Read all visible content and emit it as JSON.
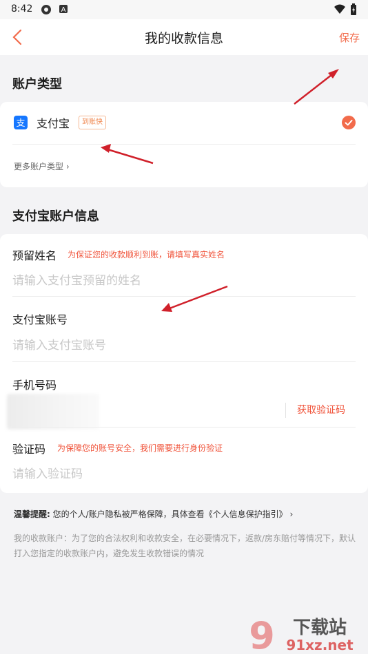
{
  "status": {
    "time": "8:42"
  },
  "header": {
    "title": "我的收款信息",
    "save_label": "保存"
  },
  "account_type": {
    "section_title": "账户类型",
    "option_name": "支付宝",
    "badge": "到账快",
    "more_label": "更多账户类型 ›"
  },
  "account_info": {
    "section_title": "支付宝账户信息",
    "name_label": "预留姓名",
    "name_hint": "为保证您的收款顺利到账，请填写真实姓名",
    "name_placeholder": "请输入支付宝预留的姓名",
    "acct_label": "支付宝账号",
    "acct_placeholder": "请输入支付宝账号",
    "phone_label": "手机号码",
    "get_code_label": "获取验证码",
    "code_label": "验证码",
    "code_hint": "为保障您的账号安全，我们需要进行身份验证",
    "code_placeholder": "请输入验证码"
  },
  "footer": {
    "tip_prefix": "温馨提醒:",
    "tip_text": " 您的个人/账户隐私被严格保障，具体查看《个人信息保护指引》 ›",
    "note": "我的收款账户：为了您的合法权利和收款安全，在必要情况下，返款/房东赔付等情况下，默认打入您指定的收款账户内，避免发生收款错误的情况"
  },
  "watermark": {
    "brand": "下载站",
    "domain": "91xz.net"
  },
  "colors": {
    "accent": "#f26b4b",
    "alipay": "#1677ff",
    "arrow": "#d0202a"
  }
}
